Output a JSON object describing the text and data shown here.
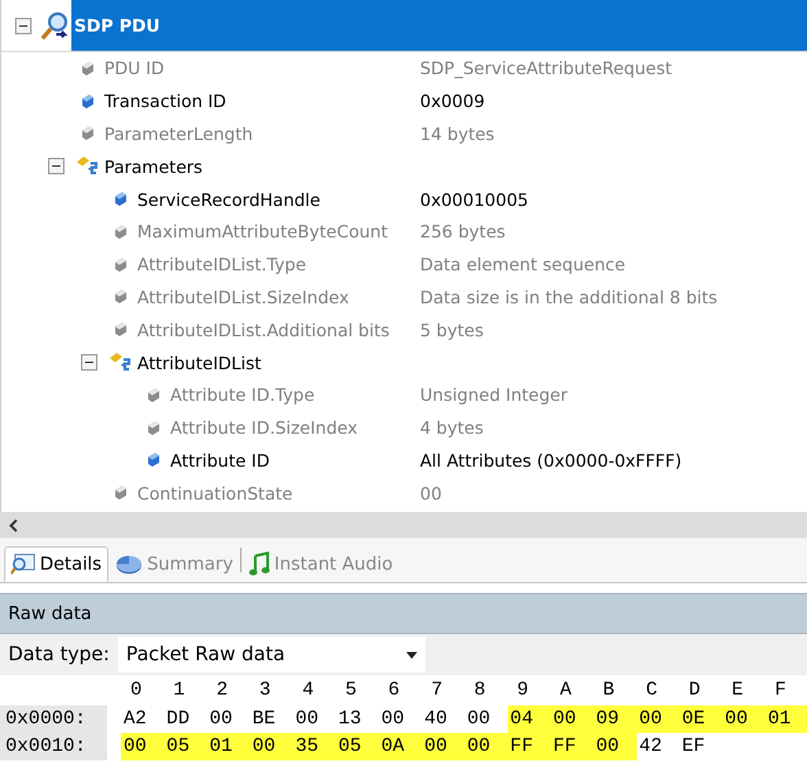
{
  "tree": {
    "label": "SDP PDU",
    "kind": "root",
    "selected": true,
    "expanded": true,
    "children": [
      {
        "label": "PDU ID",
        "value": "SDP_ServiceAttributeRequest",
        "kind": "field"
      },
      {
        "label": "Transaction ID",
        "value": "0x0009",
        "kind": "key"
      },
      {
        "label": "ParameterLength",
        "value": "14 bytes",
        "kind": "field"
      },
      {
        "label": "Parameters",
        "kind": "group",
        "expanded": true,
        "children": [
          {
            "label": "ServiceRecordHandle",
            "value": "0x00010005",
            "kind": "key"
          },
          {
            "label": "MaximumAttributeByteCount",
            "value": "256 bytes",
            "kind": "field"
          },
          {
            "label": "AttributeIDList.Type",
            "value": "Data element sequence",
            "kind": "field"
          },
          {
            "label": "AttributeIDList.SizeIndex",
            "value": "Data size is in the additional 8 bits",
            "kind": "field"
          },
          {
            "label": "AttributeIDList.Additional bits",
            "value": "5 bytes",
            "kind": "field"
          },
          {
            "label": "AttributeIDList",
            "kind": "group",
            "expanded": true,
            "children": [
              {
                "label": "Attribute ID.Type",
                "value": "Unsigned Integer",
                "kind": "field"
              },
              {
                "label": "Attribute ID.SizeIndex",
                "value": "4 bytes",
                "kind": "field"
              },
              {
                "label": "Attribute ID",
                "value": "All Attributes (0x0000-0xFFFF)",
                "kind": "key"
              }
            ]
          },
          {
            "label": "ContinuationState",
            "value": "00",
            "kind": "field"
          }
        ]
      }
    ]
  },
  "tabs": [
    {
      "label": "Details",
      "kind": "details",
      "selected": true
    },
    {
      "label": "Summary",
      "kind": "summary",
      "selected": false
    },
    {
      "label": "Instant Audio",
      "kind": "audio",
      "selected": false
    }
  ],
  "panel_title": "Raw data",
  "data_type": {
    "label": "Data type:",
    "value": "Packet Raw data"
  },
  "hex": {
    "columns": [
      "0",
      "1",
      "2",
      "3",
      "4",
      "5",
      "6",
      "7",
      "8",
      "9",
      "A",
      "B",
      "C",
      "D",
      "E",
      "F"
    ],
    "rows": [
      {
        "address": "0x0000:",
        "bytes": [
          {
            "text": "A2",
            "highlighted": false
          },
          {
            "text": "DD",
            "highlighted": false
          },
          {
            "text": "00",
            "highlighted": false
          },
          {
            "text": "BE",
            "highlighted": false
          },
          {
            "text": "00",
            "highlighted": false
          },
          {
            "text": "13",
            "highlighted": false
          },
          {
            "text": "00",
            "highlighted": false
          },
          {
            "text": "40",
            "highlighted": false
          },
          {
            "text": "00",
            "highlighted": false
          },
          {
            "text": "04",
            "highlighted": true
          },
          {
            "text": "00",
            "highlighted": true
          },
          {
            "text": "09",
            "highlighted": true
          },
          {
            "text": "00",
            "highlighted": true
          },
          {
            "text": "0E",
            "highlighted": true
          },
          {
            "text": "00",
            "highlighted": true
          },
          {
            "text": "01",
            "highlighted": true
          }
        ]
      },
      {
        "address": "0x0010:",
        "bytes": [
          {
            "text": "00",
            "highlighted": true
          },
          {
            "text": "05",
            "highlighted": true
          },
          {
            "text": "01",
            "highlighted": true
          },
          {
            "text": "00",
            "highlighted": true
          },
          {
            "text": "35",
            "highlighted": true
          },
          {
            "text": "05",
            "highlighted": true
          },
          {
            "text": "0A",
            "highlighted": true
          },
          {
            "text": "00",
            "highlighted": true
          },
          {
            "text": "00",
            "highlighted": true
          },
          {
            "text": "FF",
            "highlighted": true
          },
          {
            "text": "FF",
            "highlighted": true
          },
          {
            "text": "00",
            "highlighted": true
          },
          {
            "text": "42",
            "highlighted": false
          },
          {
            "text": "EF",
            "highlighted": false
          }
        ]
      }
    ]
  }
}
